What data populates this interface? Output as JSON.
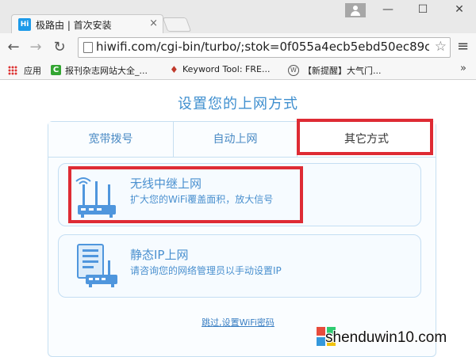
{
  "browser": {
    "tab_title": "极路由 | 首次安装",
    "tab_favicon": "Hi",
    "url": "hiwifi.com/cgi-bin/turbo/;stok=0f055a4ecb5ebd50ec89c",
    "icons": {
      "back": "arrow-left-icon",
      "forward": "arrow-right-icon",
      "reload": "reload-icon",
      "star": "star-icon",
      "menu": "hamburger-menu-icon",
      "profile": "profile-icon"
    }
  },
  "bookmarks": {
    "apps_label": "应用",
    "items": [
      {
        "label": "报刊杂志网站大全_..."
      },
      {
        "label": "Keyword Tool: FRE..."
      },
      {
        "label": "【新提醒】大气门..."
      }
    ],
    "more": "»"
  },
  "page": {
    "title": "设置您的上网方式",
    "tabs": [
      {
        "label": "宽带拨号"
      },
      {
        "label": "自动上网"
      },
      {
        "label": "其它方式"
      }
    ],
    "options": [
      {
        "title": "无线中继上网",
        "desc": "扩大您的WiFi覆盖面积，放大信号"
      },
      {
        "title": "静态IP上网",
        "desc": "请咨询您的网络管理员以手动设置IP"
      }
    ],
    "skip_link": "跳过,设置WiFi密码"
  },
  "colors": {
    "accent": "#3f8fcf",
    "highlight_box": "#de2b34",
    "panel_border": "#c6dff1"
  },
  "watermark": {
    "text": "shenduwin10.com"
  }
}
